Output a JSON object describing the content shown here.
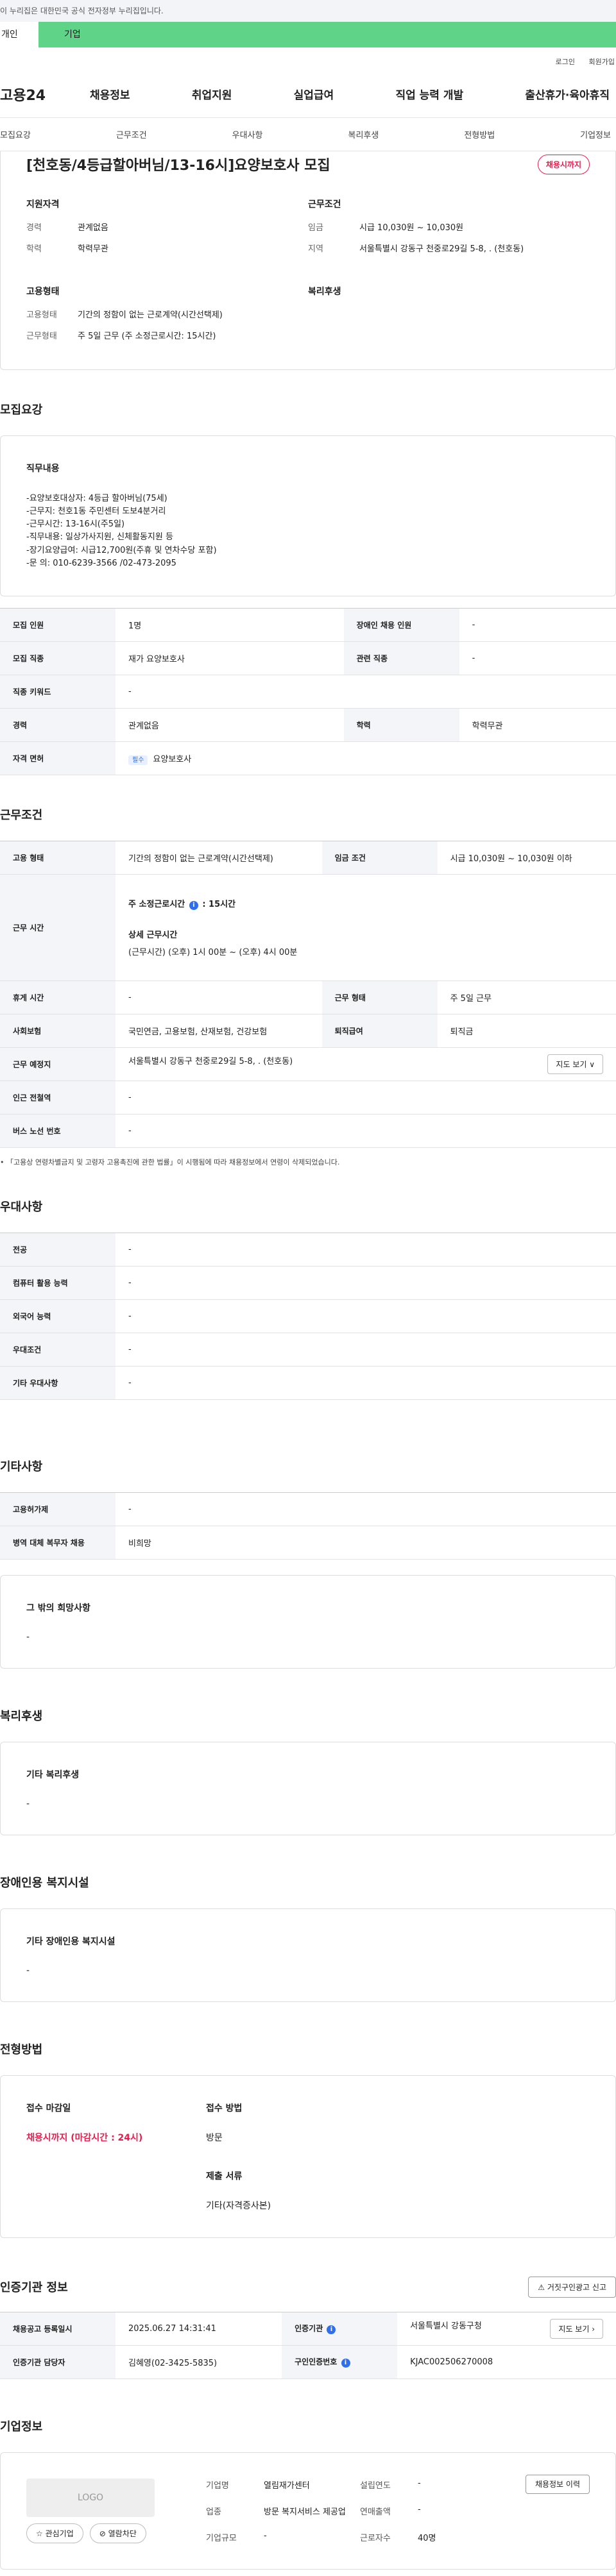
{
  "gov_banner": "이 누리집은 대한민국 공식 전자정부 누리집입니다.",
  "user_tabs": {
    "person": "개인",
    "corp": "기업"
  },
  "util_links": {
    "login": "로그인",
    "join": "회원가입"
  },
  "gnb": {
    "logo": "고용24",
    "menu": [
      "채용정보",
      "취업지원",
      "실업급여",
      "직업 능력 개발",
      "출산휴가·육아휴직"
    ]
  },
  "subtabs": [
    "모집요강",
    "근무조건",
    "우대사항",
    "복리후생",
    "전형방법",
    "기업정보"
  ],
  "summary": {
    "title": "[천호동/4등급할아버님/13-16시]요양보호사 모집",
    "badge": "채용시까지",
    "qual_title": "지원자격",
    "qual": [
      {
        "k": "경력",
        "v": "관계없음"
      },
      {
        "k": "학력",
        "v": "학력무관"
      }
    ],
    "cond_title": "근무조건",
    "cond": [
      {
        "k": "임금",
        "v": "시급 10,030원 ~ 10,030원"
      },
      {
        "k": "지역",
        "v": "서울특별시 강동구 천중로29길 5-8, . (천호동)"
      }
    ],
    "emp_title": "고용형태",
    "emp": [
      {
        "k": "고용형태",
        "v": "기간의 정함이 없는 근로계약(시간선택제)"
      },
      {
        "k": "근무형태",
        "v": "주 5일 근무 (주 소정근로시간: 15시간)"
      }
    ],
    "welfare_title": "복리후생"
  },
  "recruit": {
    "title": "모집요강",
    "duty_title": "직무내용",
    "duty_text": "-요양보호대상자: 4등급 할아버님(75세)\n-근무지: 천호1동 주민센터 도보4분거리\n-근무시간: 13-16시(주5일)\n-직무내용: 일상가사지원, 신체활동지원 등\n-장기요양급여: 시급12,700원(주휴 및 연차수당 포함)\n-문 의: 010-6239-3566 /02-473-2095",
    "rows": {
      "count_k": "모집 인원",
      "count_v": "1명",
      "disabled_k": "장애인 채용 인원",
      "disabled_v": "-",
      "job_k": "모집 직종",
      "job_v": "재가 요양보호사",
      "rel_k": "관련 직종",
      "rel_v": "-",
      "kw_k": "직종 키워드",
      "kw_v": "-",
      "career_k": "경력",
      "career_v": "관계없음",
      "edu_k": "학력",
      "edu_v": "학력무관",
      "license_k": "자격 면허",
      "license_chip": "필수",
      "license_v": "요양보호사"
    }
  },
  "work": {
    "title": "근무조건",
    "emp_k": "고용 형태",
    "emp_v": "기간의 정함이 없는 근로계약(시간선택제)",
    "wage_k": "임금 조건",
    "wage_v": "시급 10,030원 ~ 10,030원 이하",
    "hours_k": "근무 시간",
    "hours_main_label": "주 소정근로시간",
    "hours_main_value": ": 15시간",
    "hours_detail_title": "상세 근무시간",
    "hours_detail": "(근무시간) (오후) 1시 00분 ~ (오후) 4시 00분",
    "rest_k": "휴게 시간",
    "rest_v": "-",
    "form_k": "근무 형태",
    "form_v": "주 5일 근무",
    "ins_k": "사회보험",
    "ins_v": "국민연금, 고용보험, 산재보험, 건강보험",
    "ret_k": "퇴직급여",
    "ret_v": "퇴직금",
    "place_k": "근무 예정지",
    "place_v": "서울특별시 강동구 천중로29길 5-8, . (천호동)",
    "map_btn": "지도 보기 ∨",
    "station_k": "인근 전철역",
    "station_v": "-",
    "bus_k": "버스 노선 번호",
    "bus_v": "-",
    "note": "「고용상 연령차별금지 및 고령자 고용촉진에 관한 법률」이 시행됨에 따라 채용정보에서 연령이 삭제되었습니다."
  },
  "pref": {
    "title": "우대사항",
    "rows": [
      {
        "k": "전공",
        "v": "-"
      },
      {
        "k": "컴퓨터 활용 능력",
        "v": "-"
      },
      {
        "k": "외국어 능력",
        "v": "-"
      },
      {
        "k": "우대조건",
        "v": "-"
      },
      {
        "k": "기타 우대사항",
        "v": "-"
      }
    ]
  },
  "etc": {
    "title": "기타사항",
    "rows": [
      {
        "k": "고용허가제",
        "v": "-"
      },
      {
        "k": "병역 대체 복무자 채용",
        "v": "비희망"
      }
    ],
    "other_title": "그 밖의 희망사항",
    "other_v": "-"
  },
  "welfare": {
    "title": "복리후생",
    "box_title": "기타 복리후생",
    "box_v": "-"
  },
  "disabled_fac": {
    "title": "장애인용 복지시설",
    "box_title": "기타 장애인용 복지시설",
    "box_v": "-"
  },
  "screen": {
    "title": "전형방법",
    "deadline_k": "접수 마감일",
    "deadline_v": "채용시까지 (마감시간 : 24시)",
    "method_k": "접수 방법",
    "method_v": "방문",
    "docs_k": "제출 서류",
    "docs_v": "기타(자격증사본)"
  },
  "agency": {
    "title": "인증기관 정보",
    "report_btn": "거짓구인광고 신고",
    "reg_k": "채용공고 등록일시",
    "reg_v": "2025.06.27 14:31:41",
    "org_k": "인증기관",
    "org_v": "서울특별시 강동구청",
    "map_btn": "지도 보기 ›",
    "mgr_k": "인증기관 담당자",
    "mgr_v": "김혜영(02-3425-5835)",
    "num_k": "구인인증번호",
    "num_v": "KJAC002506270008"
  },
  "corp": {
    "title": "기업정보",
    "logo": "LOGO",
    "fav_btn": "관심기업",
    "block_btn": "열람차단",
    "name_k": "기업명",
    "name_v": "열림재가센터",
    "ind_k": "업종",
    "ind_v": "방문 복지서비스 제공업",
    "size_k": "기업규모",
    "size_v": "-",
    "year_k": "설립연도",
    "year_v": "-",
    "sales_k": "연매출액",
    "sales_v": "-",
    "staff_k": "근로자수",
    "staff_v": "40명",
    "history_btn": "채용정보 이력"
  }
}
